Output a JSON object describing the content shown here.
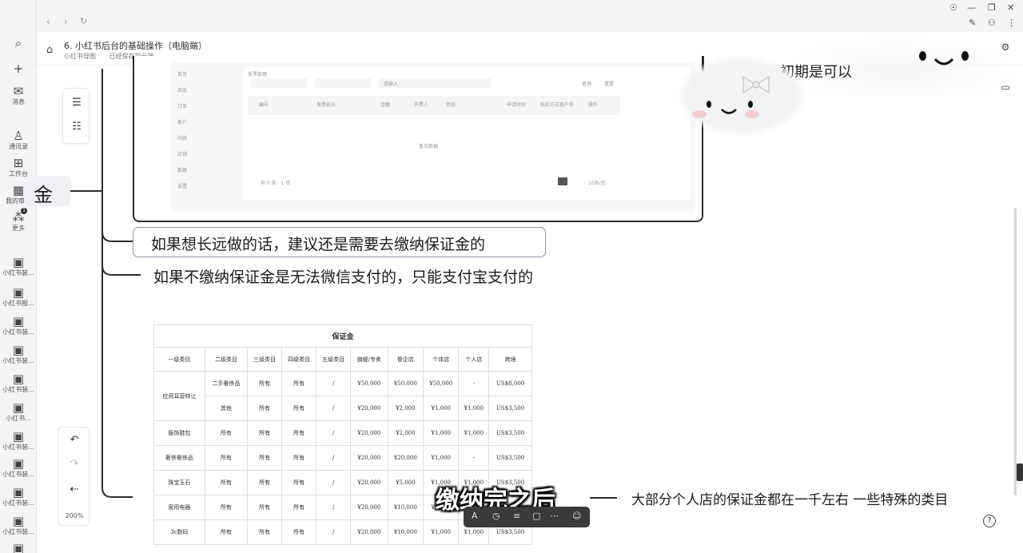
{
  "app": {
    "sidebar": [
      {
        "icon": "search-icon",
        "label": ""
      },
      {
        "icon": "plus-icon",
        "label": ""
      },
      {
        "icon": "message-icon",
        "label": "消息"
      },
      {
        "icon": "contacts-icon",
        "label": "通讯录"
      },
      {
        "icon": "workbench-icon",
        "label": "工作台"
      },
      {
        "icon": "calendar-icon",
        "label": "我的审批"
      },
      {
        "icon": "more-icon",
        "label": "更多",
        "badge": "1"
      },
      {
        "icon": "doc-icon",
        "label": "小红书装..."
      },
      {
        "icon": "doc-icon",
        "label": "小红书报..."
      },
      {
        "icon": "doc-icon",
        "label": "小红书装..."
      },
      {
        "icon": "doc-icon",
        "label": "小红书装..."
      },
      {
        "icon": "doc-icon",
        "label": "小红书装..."
      },
      {
        "icon": "doc-icon",
        "label": "小红书..."
      },
      {
        "icon": "doc-icon",
        "label": "小红书装..."
      },
      {
        "icon": "doc-icon",
        "label": "小红书装..."
      },
      {
        "icon": "doc-icon",
        "label": "小红书装..."
      },
      {
        "icon": "doc-icon",
        "label": "小红书装..."
      },
      {
        "icon": "doc-icon",
        "label": "小红书..."
      }
    ]
  },
  "doc": {
    "title": "6. 小红书后台的基础操作（电脑端）",
    "meta_owner": "小红书导图",
    "meta_status": "已经保存到云端"
  },
  "canvas": {
    "zoom": "200%",
    "root": "金",
    "branch1": "如果想长远做的话，建议还是需要去缴纳保证金的",
    "branch2": "如果不缴纳保证金是无法微信支付的，只能支付宝支付的",
    "branch3": "大部分个人店的保证金都在一千左右 一些特殊的类目",
    "cutoff_text": "初期是可以"
  },
  "embed": {
    "side_items": [
      "首页",
      "商品",
      "订单",
      "客户",
      "内容",
      "店铺",
      "数据",
      "设置"
    ],
    "filter_label": "发票管理",
    "search_placeholder": "请输入",
    "btn_query": "查询",
    "btn_reset": "重置",
    "columns": [
      "编号",
      "发票抬头",
      "金额",
      "开票人",
      "状态",
      "申请时间",
      "抵扣方式客户名",
      "操作"
    ],
    "empty": "暂无数据",
    "pager": "共 0 条，1 页",
    "page_size": "10条/页"
  },
  "deposit_table": {
    "caption": "保证金",
    "headers": [
      "一级类目",
      "二级类目",
      "三级类目",
      "四级类目",
      "五级类目",
      "旗舰/专卖",
      "普企店",
      "个体店",
      "个人店",
      "跨境"
    ],
    "rows": [
      [
        "应用耳营特让",
        "二手奢侈品",
        "所有",
        "所有",
        "/",
        "¥50,000",
        "¥50,000",
        "¥50,000",
        "-",
        "US$8,000"
      ],
      [
        "",
        "其他",
        "所有",
        "所有",
        "/",
        "¥20,000",
        "¥2,000",
        "¥1,000",
        "¥1,000",
        "US$3,500"
      ],
      [
        "服饰鞋包",
        "所有",
        "所有",
        "所有",
        "/",
        "¥20,000",
        "¥2,000",
        "¥1,000",
        "¥1,000",
        "US$3,500"
      ],
      [
        "奢侈奢侈品",
        "所有",
        "所有",
        "所有",
        "/",
        "¥20,000",
        "¥20,000",
        "¥1,000",
        "-",
        "US$3,500"
      ],
      [
        "珠宝玉石",
        "所有",
        "所有",
        "所有",
        "/",
        "¥20,000",
        "¥5,000",
        "¥1,000",
        "¥1,000",
        "US$3,500"
      ],
      [
        "家用电器",
        "所有",
        "所有",
        "所有",
        "/",
        "¥20,000",
        "¥10,000",
        "¥1,000",
        "¥1,000",
        "US$3,500"
      ],
      [
        "3c数码",
        "所有",
        "所有",
        "所有",
        "/",
        "¥20,000",
        "¥10,000",
        "¥1,000",
        "¥1,000",
        "US$3,500"
      ]
    ]
  },
  "overlay": {
    "subtitle": "缴纳完之后"
  },
  "colors": {
    "ink": "#1b1b1b",
    "line": "#2b2b2b",
    "node_border": "#8c96a4"
  }
}
